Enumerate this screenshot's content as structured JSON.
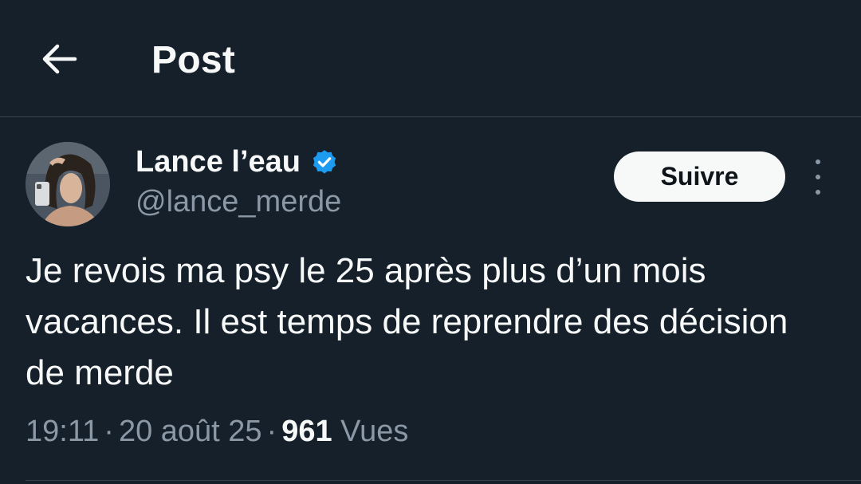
{
  "header": {
    "title": "Post"
  },
  "author": {
    "display_name": "Lance l’eau",
    "handle": "@lance_merde",
    "verified": true
  },
  "actions": {
    "follow_label": "Suivre"
  },
  "tweet": {
    "text": "Je revois ma psy le 25 après plus d’un mois vacances. Il est temps de reprendre des décision de merde",
    "time": "19:11",
    "date": "20 août 25",
    "views_count": "961",
    "views_label": "Vues"
  },
  "colors": {
    "background": "#15202b",
    "text_primary": "#f7f9f9",
    "text_secondary": "#8b98a5",
    "verified_badge": "#1d9bf0",
    "divider": "#38444d"
  },
  "icons": {
    "back": "arrow-left-icon",
    "verified": "verified-badge-icon",
    "more": "more-vertical-icon"
  }
}
